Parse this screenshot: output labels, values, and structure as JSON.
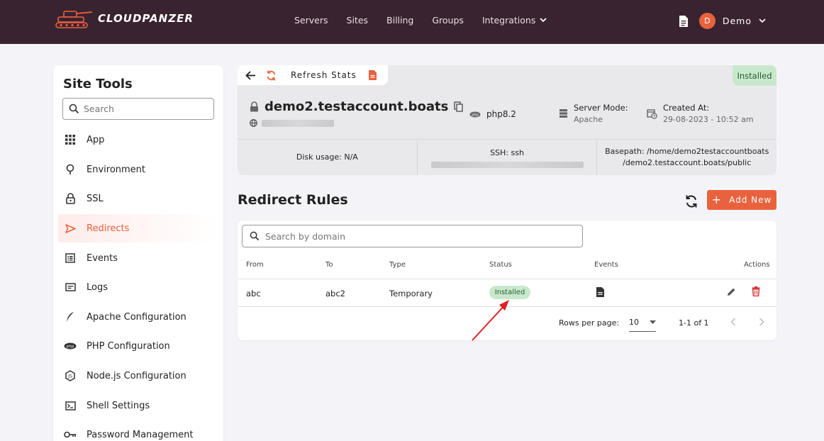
{
  "app": {
    "brand": "CLOUDPANZER"
  },
  "nav": {
    "items": [
      {
        "label": "Servers"
      },
      {
        "label": "Sites"
      },
      {
        "label": "Billing"
      },
      {
        "label": "Groups"
      },
      {
        "label": "Integrations"
      }
    ],
    "user": {
      "initial": "D",
      "name": "Demo"
    }
  },
  "sidebar": {
    "title": "Site Tools",
    "search_placeholder": "Search",
    "items": [
      {
        "label": "App",
        "icon": "grid-icon"
      },
      {
        "label": "Environment",
        "icon": "environment-icon"
      },
      {
        "label": "SSL",
        "icon": "lock-icon"
      },
      {
        "label": "Redirects",
        "icon": "send-icon",
        "active": true
      },
      {
        "label": "Events",
        "icon": "list-icon"
      },
      {
        "label": "Logs",
        "icon": "logs-icon"
      },
      {
        "label": "Apache Configuration",
        "icon": "feather-icon"
      },
      {
        "label": "PHP Configuration",
        "icon": "php-icon"
      },
      {
        "label": "Node.js Configuration",
        "icon": "nodejs-icon"
      },
      {
        "label": "Shell Settings",
        "icon": "terminal-icon"
      },
      {
        "label": "Password Management",
        "icon": "key-icon"
      }
    ]
  },
  "site": {
    "refresh_label": "Refresh Stats",
    "status": "Installed",
    "domain": "demo2.testaccount.boats",
    "php": "php8.2",
    "server_mode_title": "Server Mode:",
    "server_mode": "Apache",
    "created_title": "Created At:",
    "created": "29-08-2023 - 10:52 am",
    "disk_usage": "Disk usage: N/A",
    "ssh": "SSH: ssh",
    "basepath_line1": "Basepath: /home/demo2testaccountboats",
    "basepath_line2": "/demo2.testaccount.boats/public"
  },
  "redirects": {
    "title": "Redirect Rules",
    "add_label": "Add New",
    "search_placeholder": "Search by domain",
    "columns": {
      "from": "From",
      "to": "To",
      "type": "Type",
      "status": "Status",
      "events": "Events",
      "actions": "Actions"
    },
    "rows": [
      {
        "from": "abc",
        "to": "abc2",
        "type": "Temporary",
        "status": "Installed"
      }
    ],
    "pagination": {
      "rows_per_page_label": "Rows per page:",
      "rows_per_page": "10",
      "range": "1-1 of 1"
    }
  },
  "colors": {
    "topbar": "#3a2330",
    "accent": "#e8623d",
    "success_bg": "#c8e8cc"
  }
}
